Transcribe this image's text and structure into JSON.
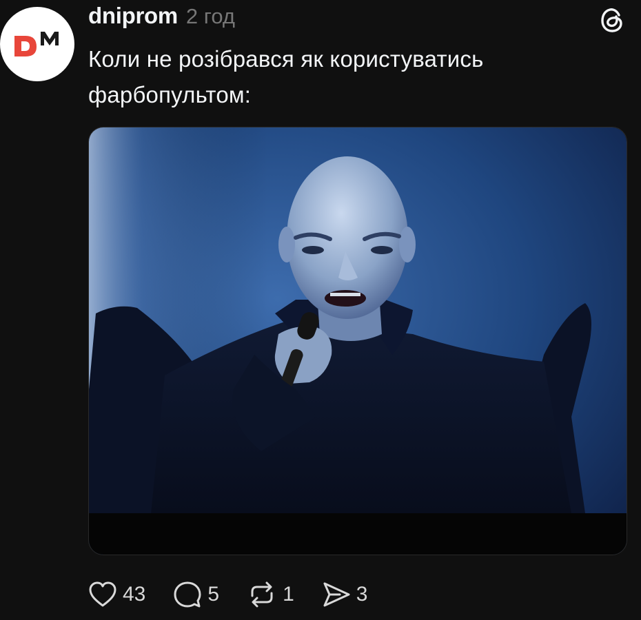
{
  "post": {
    "author": "dniprom",
    "time": "2 год",
    "text": "Коли не розібрався як користуватись фарбопультом:",
    "avatar_logo_icon": "dm-logo",
    "platform_icon": "threads-icon",
    "media": {
      "kind": "photo",
      "icon": "performer-photo"
    }
  },
  "actions": {
    "likes": {
      "icon": "heart-icon",
      "count": "43"
    },
    "replies": {
      "icon": "comment-icon",
      "count": "5"
    },
    "reposts": {
      "icon": "repost-icon",
      "count": "1"
    },
    "shares": {
      "icon": "send-icon",
      "count": "3"
    }
  },
  "colors": {
    "background": "#101010",
    "text": "#f3f5f7",
    "muted": "#777777",
    "logo_red": "#e8463a",
    "logo_dark": "#1a1a1a"
  }
}
